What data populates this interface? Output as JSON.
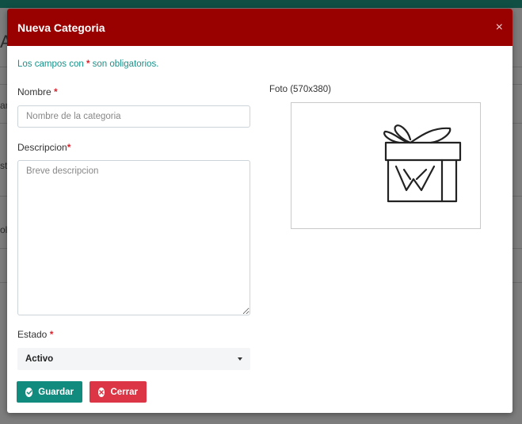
{
  "backdrop": {
    "fragment_1": "AR",
    "fragment_2": "an",
    "fragment_3": "st",
    "fragment_4": "ola"
  },
  "modal": {
    "title": "Nueva Categoria",
    "close_glyph": "×",
    "required_note_prefix": "Los campos con",
    "required_note_asterisk": "*",
    "required_note_suffix": "son obligatorios."
  },
  "form": {
    "nombre": {
      "label": "Nombre",
      "asterisk": "*",
      "placeholder": "Nombre de la categoria",
      "value": ""
    },
    "descripcion": {
      "label": "Descripcion",
      "asterisk": "*",
      "placeholder": "Breve descripcion",
      "value": ""
    },
    "estado": {
      "label": "Estado",
      "asterisk": "*",
      "selected": "Activo"
    },
    "foto": {
      "label": "Foto (570x380)",
      "image_icon": "gift-icon"
    }
  },
  "buttons": {
    "guardar": {
      "label": "Guardar",
      "icon": "check-circle-icon",
      "color": "#108b7e"
    },
    "cerrar": {
      "label": "Cerrar",
      "icon": "x-circle-icon",
      "color": "#dc3545"
    }
  },
  "colors": {
    "header": "#990000",
    "note_text": "#17928a",
    "required": "#d9232d"
  }
}
